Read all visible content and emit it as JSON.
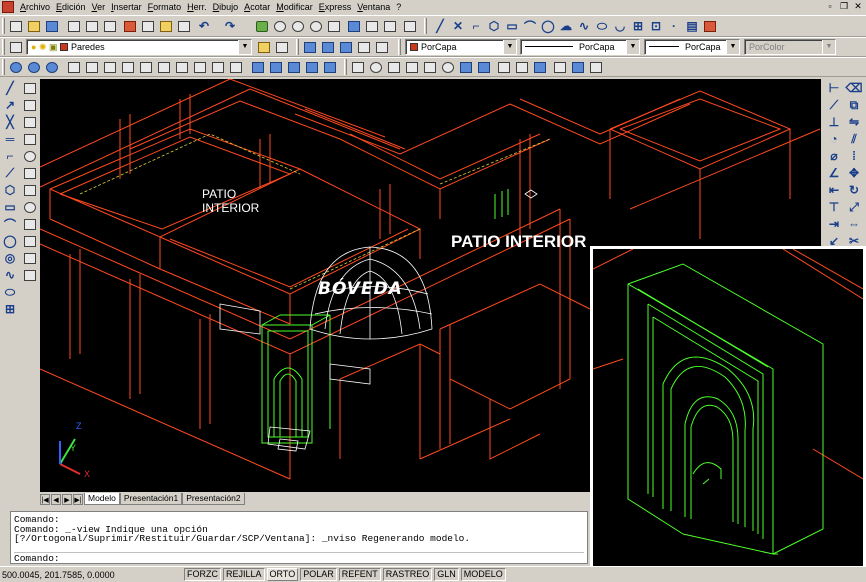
{
  "menu": [
    "Archivo",
    "Edición",
    "Ver",
    "Insertar",
    "Formato",
    "Herr.",
    "Dibujo",
    "Acotar",
    "Modificar",
    "Express",
    "Ventana",
    "?"
  ],
  "layer_combo": "Paredes",
  "color_combo": "PorCapa",
  "linetype_combo": "PorCapa",
  "lineweight_combo": "PorCapa",
  "plotstyle_combo": "PorColor",
  "labels": {
    "patio_small": "PATIO\nINTERIOR",
    "patio_large": "PATIO INTERIOR",
    "boveda": "BÓVEDA"
  },
  "ucs": {
    "x": "X",
    "y": "Y",
    "z": "Z"
  },
  "tabs": [
    "Modelo",
    "Presentación1",
    "Presentación2"
  ],
  "command_lines": [
    "Comando:",
    "Comando: _-view Indique una opción",
    "[?/Ortogonal/Suprimir/Restituir/Guardar/SCP/Ventana]: _nviso Regenerando modelo."
  ],
  "command_prompt": "Comando:",
  "status": {
    "coords": "500.0045, 201.7585, 0.0000",
    "buttons": [
      "FORZC",
      "REJILLA",
      "ORTO",
      "POLAR",
      "REFENT",
      "RASTREO",
      "GLN",
      "MODELO"
    ]
  },
  "colors": {
    "walls": "#ff4a20",
    "arch": "#4cff2a",
    "background": "#000000",
    "linework": "#ffffff"
  }
}
